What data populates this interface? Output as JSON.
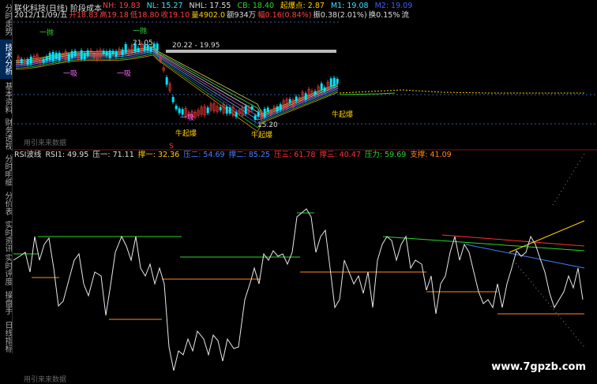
{
  "colors": {
    "up": "#ff3b3b",
    "down": "#00e5ff",
    "green": "#2cd62c",
    "orange": "#ff8c1a",
    "grid": "#3a5aa0",
    "text": "#cccccc",
    "rsi": "#e8e8e8"
  },
  "title": "联化科技(日线) 阶段成本",
  "header1": [
    {
      "t": "NH: 19.83",
      "c": "#ff4040"
    },
    {
      "t": "NL: 15.27",
      "c": "#40e0ff"
    },
    {
      "t": "NHL: 17.55",
      "c": "#ddd"
    },
    {
      "t": "CB: 18.40",
      "c": "#2cd62c"
    },
    {
      "t": "起爆点: 2.87",
      "c": "#ffd000"
    },
    {
      "t": "M1: 19.08",
      "c": "#40e0ff"
    },
    {
      "t": "M2: 19.09",
      "c": "#4060ff"
    }
  ],
  "header2": [
    {
      "t": "2012/11/09/五",
      "c": "#ddd"
    },
    {
      "t": "开18.83",
      "c": "#ff4040"
    },
    {
      "t": "高19.18",
      "c": "#ff4040"
    },
    {
      "t": "低18.80",
      "c": "#ff4040"
    },
    {
      "t": "收19.10",
      "c": "#ff4040"
    },
    {
      "t": "量4902.0",
      "c": "#ffd000"
    },
    {
      "t": "额934万",
      "c": "#ddd"
    },
    {
      "t": "幅0.16(0.84%)",
      "c": "#ff4040"
    },
    {
      "t": "振0.38(2.01%)",
      "c": "#ddd"
    },
    {
      "t": "换0.15%",
      "c": "#ddd"
    },
    {
      "t": "流",
      "c": "#ddd"
    }
  ],
  "rsi_header": [
    {
      "t": "RSI波线",
      "c": "#ddd"
    },
    {
      "t": "RSI1: 49.95",
      "c": "#ddd"
    },
    {
      "t": "压一: 71.11",
      "c": "#ddd"
    },
    {
      "t": "撑一: 32.36",
      "c": "#ffd000"
    },
    {
      "t": "压二: 54.69",
      "c": "#4080ff"
    },
    {
      "t": "撑二: 85.25",
      "c": "#4080ff"
    },
    {
      "t": "压三: 61.78",
      "c": "#ff3030"
    },
    {
      "t": "撑三: 40.47",
      "c": "#ff3030"
    },
    {
      "t": "压力: 59.69",
      "c": "#2cd62c"
    },
    {
      "t": "支撑: 41.09",
      "c": "#ff8c1a"
    }
  ],
  "price_labels": {
    "high": "21.05",
    "range": "20.22 - 19.95",
    "low": "15.20",
    "up_buy": "一抛",
    "down_buy": "一吸",
    "boom": "牛起爆",
    "sell_mark": "S"
  },
  "left_tabs_top": [
    "分时走势",
    "技术分析",
    "基本资料",
    "财务透视"
  ],
  "left_tabs_bottom": [
    "分时明细",
    "分价表",
    "实时资讯",
    "实时评度",
    "操盘手",
    "日线指标"
  ],
  "footer": "用引来来数据",
  "watermark": "www.7gpzb.com"
}
